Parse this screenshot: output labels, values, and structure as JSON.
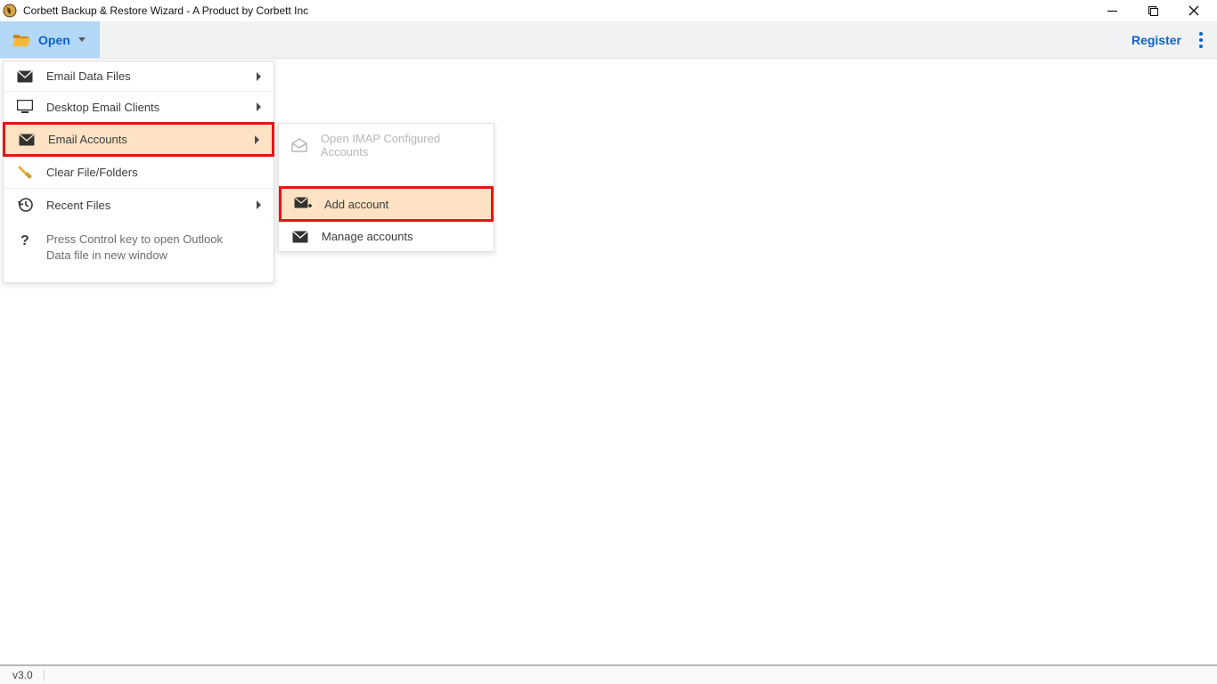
{
  "window": {
    "title": "Corbett Backup & Restore Wizard - A Product by Corbett Inc"
  },
  "toolbar": {
    "open_label": "Open",
    "register_label": "Register"
  },
  "menu": {
    "items": [
      {
        "label": "Email Data Files"
      },
      {
        "label": "Desktop Email Clients"
      },
      {
        "label": "Email Accounts"
      },
      {
        "label": "Clear File/Folders"
      },
      {
        "label": "Recent Files"
      }
    ],
    "hint": "Press Control key to open Outlook Data file in new window"
  },
  "submenu": {
    "open_imap": "Open IMAP Configured Accounts",
    "add_account": "Add account",
    "manage_accounts": "Manage accounts"
  },
  "status": {
    "version": "v3.0"
  }
}
